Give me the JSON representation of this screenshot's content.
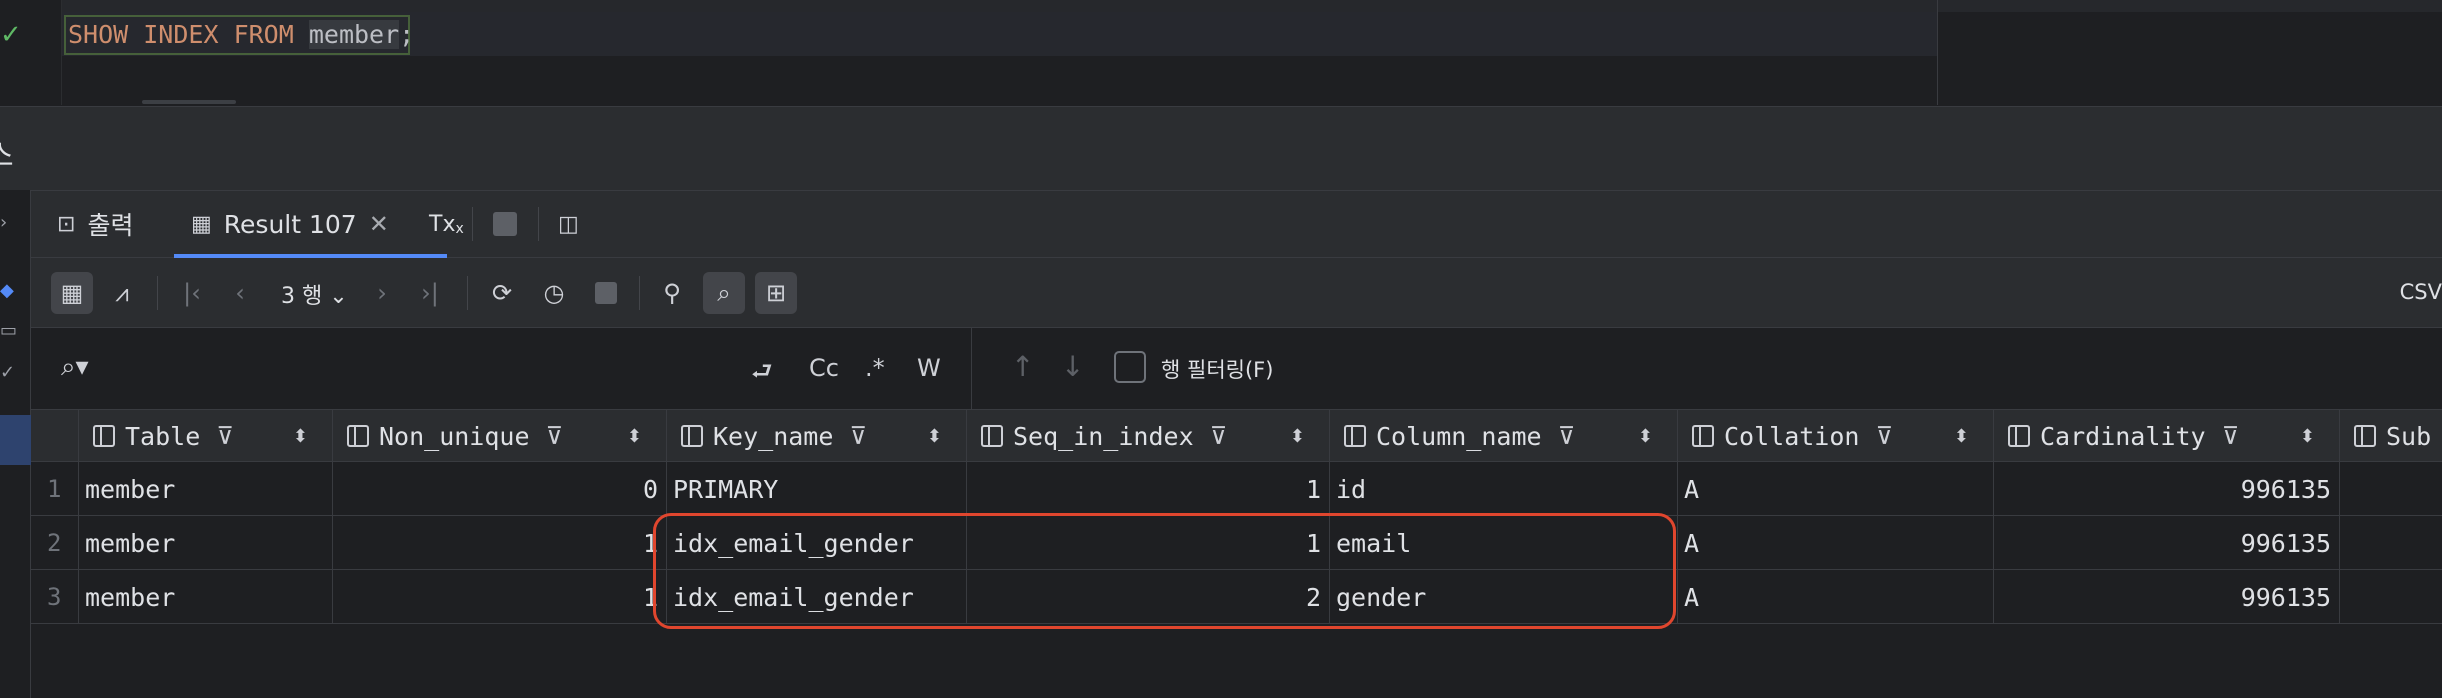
{
  "editor": {
    "sql_keywords": "SHOW INDEX FROM",
    "sql_table": "member",
    "sql_end": ";",
    "status_icon": "check-icon"
  },
  "services": {
    "title": "스"
  },
  "tabs": [
    {
      "label": "출력",
      "icon": "terminal-icon"
    },
    {
      "label": "Result 107",
      "icon": "table-icon",
      "active": true
    },
    {
      "label": "Tx",
      "icon": "transaction-icon"
    }
  ],
  "toolbar": {
    "row_count": "3 행",
    "export_label": "CSV"
  },
  "search": {
    "match_case": "Cc",
    "regex": ".*",
    "words": "W",
    "filter_label": "행 필터링(F)"
  },
  "grid": {
    "columns": [
      "Table",
      "Non_unique",
      "Key_name",
      "Seq_in_index",
      "Column_name",
      "Collation",
      "Cardinality",
      "Sub"
    ],
    "rows": [
      {
        "num": "1",
        "Table": "member",
        "Non_unique": "0",
        "Key_name": "PRIMARY",
        "Seq_in_index": "1",
        "Column_name": "id",
        "Collation": "A",
        "Cardinality": "996135"
      },
      {
        "num": "2",
        "Table": "member",
        "Non_unique": "1",
        "Key_name": "idx_email_gender",
        "Seq_in_index": "1",
        "Column_name": "email",
        "Collation": "A",
        "Cardinality": "996135"
      },
      {
        "num": "3",
        "Table": "member",
        "Non_unique": "1",
        "Key_name": "idx_email_gender",
        "Seq_in_index": "2",
        "Column_name": "gender",
        "Collation": "A",
        "Cardinality": "996135"
      }
    ]
  },
  "colors": {
    "accent": "#548af7",
    "highlight": "#e0462e",
    "keyword": "#cf8e6d",
    "success": "#5fb865"
  }
}
